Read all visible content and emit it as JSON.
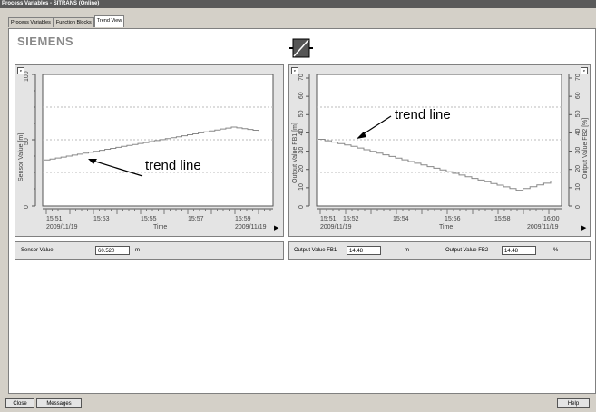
{
  "window": {
    "title": "Process Variables - SITRANS (Online)"
  },
  "tabs": [
    {
      "label": "Process Variables"
    },
    {
      "label": "Function Blocks"
    },
    {
      "label": "Trend View"
    }
  ],
  "brand": "SIEMENS",
  "icons": {
    "device": "device-block-icon",
    "corner": "pin-icon",
    "scroll": "scroll-right-icon"
  },
  "left_chart": {
    "ylabel": "Sensor Value [m]",
    "yticks": [
      "0",
      "50",
      "100"
    ],
    "xticks": [
      "15:51",
      "15:53",
      "15:55",
      "15:57",
      "15:59"
    ],
    "date_left": "2009/11/19",
    "date_right": "2009/11/19",
    "xlabel": "Time",
    "annotation": "trend line"
  },
  "right_chart": {
    "ylabel_left": "Output Value FB1 [m]",
    "ylabel_right": "Output Value FB2 [%]",
    "yticks": [
      "0",
      "10",
      "20",
      "30",
      "40",
      "50",
      "60",
      "70"
    ],
    "xticks": [
      "15:51",
      "15:52",
      "15:54",
      "15:56",
      "15:58",
      "16:00"
    ],
    "date_left": "2009/11/19",
    "date_right": "2009/11/19",
    "xlabel": "Time",
    "annotation": "trend line"
  },
  "values": {
    "sensor_label": "Sensor Value",
    "sensor_value": "60.520",
    "sensor_unit": "m",
    "fb1_label": "Output Value FB1",
    "fb1_value": "14.48",
    "fb1_unit": "m",
    "fb2_label": "Output Value FB2",
    "fb2_value": "14.48",
    "fb2_unit": "%"
  },
  "buttons": {
    "close": "Close",
    "messages": "Messages",
    "help": "Help"
  },
  "chart_data": [
    {
      "type": "line",
      "ylabel": "Sensor Value [m]",
      "xlabel": "Time",
      "ylim": [
        0,
        100
      ],
      "series": [
        {
          "x": [
            "15:51",
            "15:59",
            "16:00"
          ],
          "values": [
            35,
            60,
            57
          ]
        }
      ]
    },
    {
      "type": "line",
      "ylabel": "Output Value FB1 [m]",
      "xlabel": "Time",
      "ylim": [
        0,
        75
      ],
      "series": [
        {
          "x": [
            "15:51",
            "15:52",
            "15:58:30",
            "16:00"
          ],
          "values": [
            38,
            34,
            9,
            14
          ]
        }
      ]
    }
  ]
}
